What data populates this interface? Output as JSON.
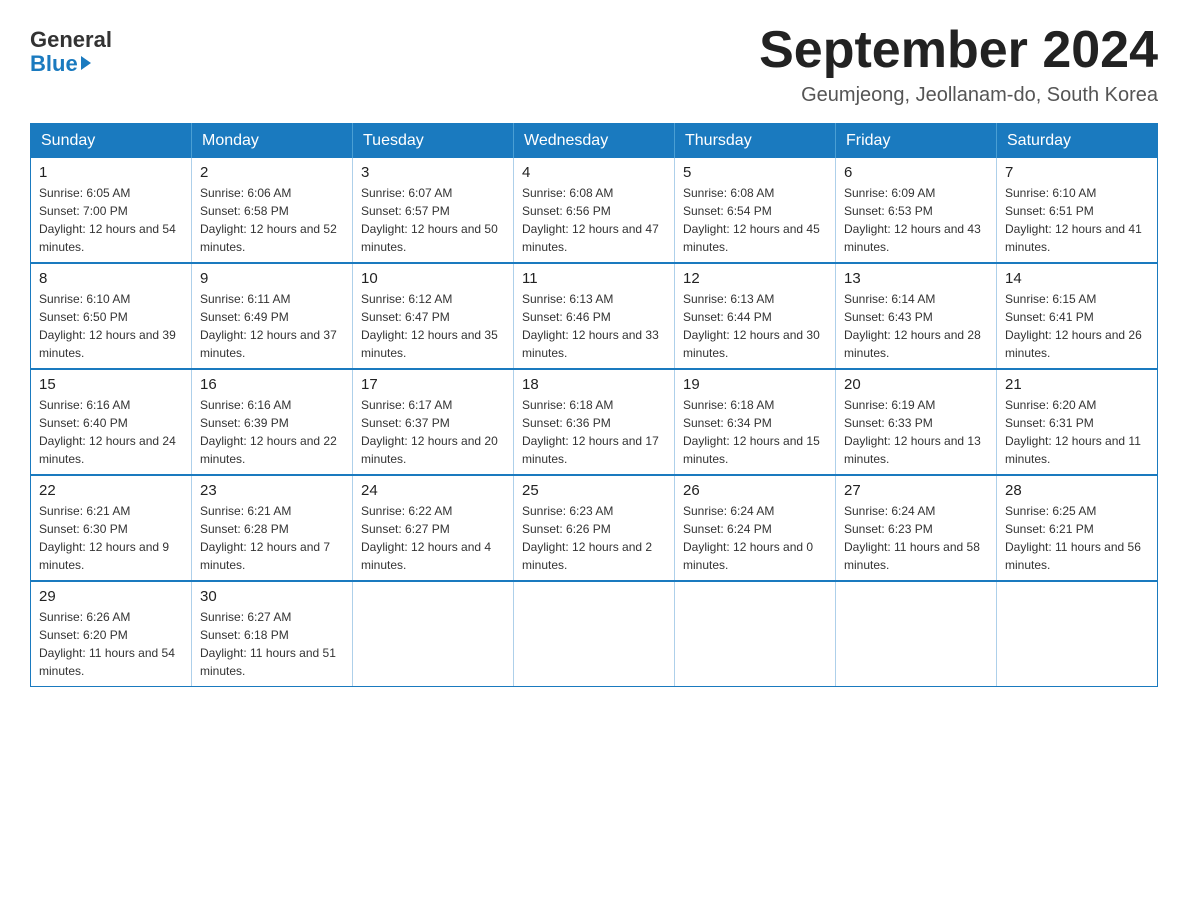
{
  "logo": {
    "general": "General",
    "blue": "Blue"
  },
  "title": "September 2024",
  "location": "Geumjeong, Jeollanam-do, South Korea",
  "headers": [
    "Sunday",
    "Monday",
    "Tuesday",
    "Wednesday",
    "Thursday",
    "Friday",
    "Saturday"
  ],
  "weeks": [
    [
      {
        "day": "1",
        "sunrise": "6:05 AM",
        "sunset": "7:00 PM",
        "daylight": "12 hours and 54 minutes."
      },
      {
        "day": "2",
        "sunrise": "6:06 AM",
        "sunset": "6:58 PM",
        "daylight": "12 hours and 52 minutes."
      },
      {
        "day": "3",
        "sunrise": "6:07 AM",
        "sunset": "6:57 PM",
        "daylight": "12 hours and 50 minutes."
      },
      {
        "day": "4",
        "sunrise": "6:08 AM",
        "sunset": "6:56 PM",
        "daylight": "12 hours and 47 minutes."
      },
      {
        "day": "5",
        "sunrise": "6:08 AM",
        "sunset": "6:54 PM",
        "daylight": "12 hours and 45 minutes."
      },
      {
        "day": "6",
        "sunrise": "6:09 AM",
        "sunset": "6:53 PM",
        "daylight": "12 hours and 43 minutes."
      },
      {
        "day": "7",
        "sunrise": "6:10 AM",
        "sunset": "6:51 PM",
        "daylight": "12 hours and 41 minutes."
      }
    ],
    [
      {
        "day": "8",
        "sunrise": "6:10 AM",
        "sunset": "6:50 PM",
        "daylight": "12 hours and 39 minutes."
      },
      {
        "day": "9",
        "sunrise": "6:11 AM",
        "sunset": "6:49 PM",
        "daylight": "12 hours and 37 minutes."
      },
      {
        "day": "10",
        "sunrise": "6:12 AM",
        "sunset": "6:47 PM",
        "daylight": "12 hours and 35 minutes."
      },
      {
        "day": "11",
        "sunrise": "6:13 AM",
        "sunset": "6:46 PM",
        "daylight": "12 hours and 33 minutes."
      },
      {
        "day": "12",
        "sunrise": "6:13 AM",
        "sunset": "6:44 PM",
        "daylight": "12 hours and 30 minutes."
      },
      {
        "day": "13",
        "sunrise": "6:14 AM",
        "sunset": "6:43 PM",
        "daylight": "12 hours and 28 minutes."
      },
      {
        "day": "14",
        "sunrise": "6:15 AM",
        "sunset": "6:41 PM",
        "daylight": "12 hours and 26 minutes."
      }
    ],
    [
      {
        "day": "15",
        "sunrise": "6:16 AM",
        "sunset": "6:40 PM",
        "daylight": "12 hours and 24 minutes."
      },
      {
        "day": "16",
        "sunrise": "6:16 AM",
        "sunset": "6:39 PM",
        "daylight": "12 hours and 22 minutes."
      },
      {
        "day": "17",
        "sunrise": "6:17 AM",
        "sunset": "6:37 PM",
        "daylight": "12 hours and 20 minutes."
      },
      {
        "day": "18",
        "sunrise": "6:18 AM",
        "sunset": "6:36 PM",
        "daylight": "12 hours and 17 minutes."
      },
      {
        "day": "19",
        "sunrise": "6:18 AM",
        "sunset": "6:34 PM",
        "daylight": "12 hours and 15 minutes."
      },
      {
        "day": "20",
        "sunrise": "6:19 AM",
        "sunset": "6:33 PM",
        "daylight": "12 hours and 13 minutes."
      },
      {
        "day": "21",
        "sunrise": "6:20 AM",
        "sunset": "6:31 PM",
        "daylight": "12 hours and 11 minutes."
      }
    ],
    [
      {
        "day": "22",
        "sunrise": "6:21 AM",
        "sunset": "6:30 PM",
        "daylight": "12 hours and 9 minutes."
      },
      {
        "day": "23",
        "sunrise": "6:21 AM",
        "sunset": "6:28 PM",
        "daylight": "12 hours and 7 minutes."
      },
      {
        "day": "24",
        "sunrise": "6:22 AM",
        "sunset": "6:27 PM",
        "daylight": "12 hours and 4 minutes."
      },
      {
        "day": "25",
        "sunrise": "6:23 AM",
        "sunset": "6:26 PM",
        "daylight": "12 hours and 2 minutes."
      },
      {
        "day": "26",
        "sunrise": "6:24 AM",
        "sunset": "6:24 PM",
        "daylight": "12 hours and 0 minutes."
      },
      {
        "day": "27",
        "sunrise": "6:24 AM",
        "sunset": "6:23 PM",
        "daylight": "11 hours and 58 minutes."
      },
      {
        "day": "28",
        "sunrise": "6:25 AM",
        "sunset": "6:21 PM",
        "daylight": "11 hours and 56 minutes."
      }
    ],
    [
      {
        "day": "29",
        "sunrise": "6:26 AM",
        "sunset": "6:20 PM",
        "daylight": "11 hours and 54 minutes."
      },
      {
        "day": "30",
        "sunrise": "6:27 AM",
        "sunset": "6:18 PM",
        "daylight": "11 hours and 51 minutes."
      },
      null,
      null,
      null,
      null,
      null
    ]
  ]
}
